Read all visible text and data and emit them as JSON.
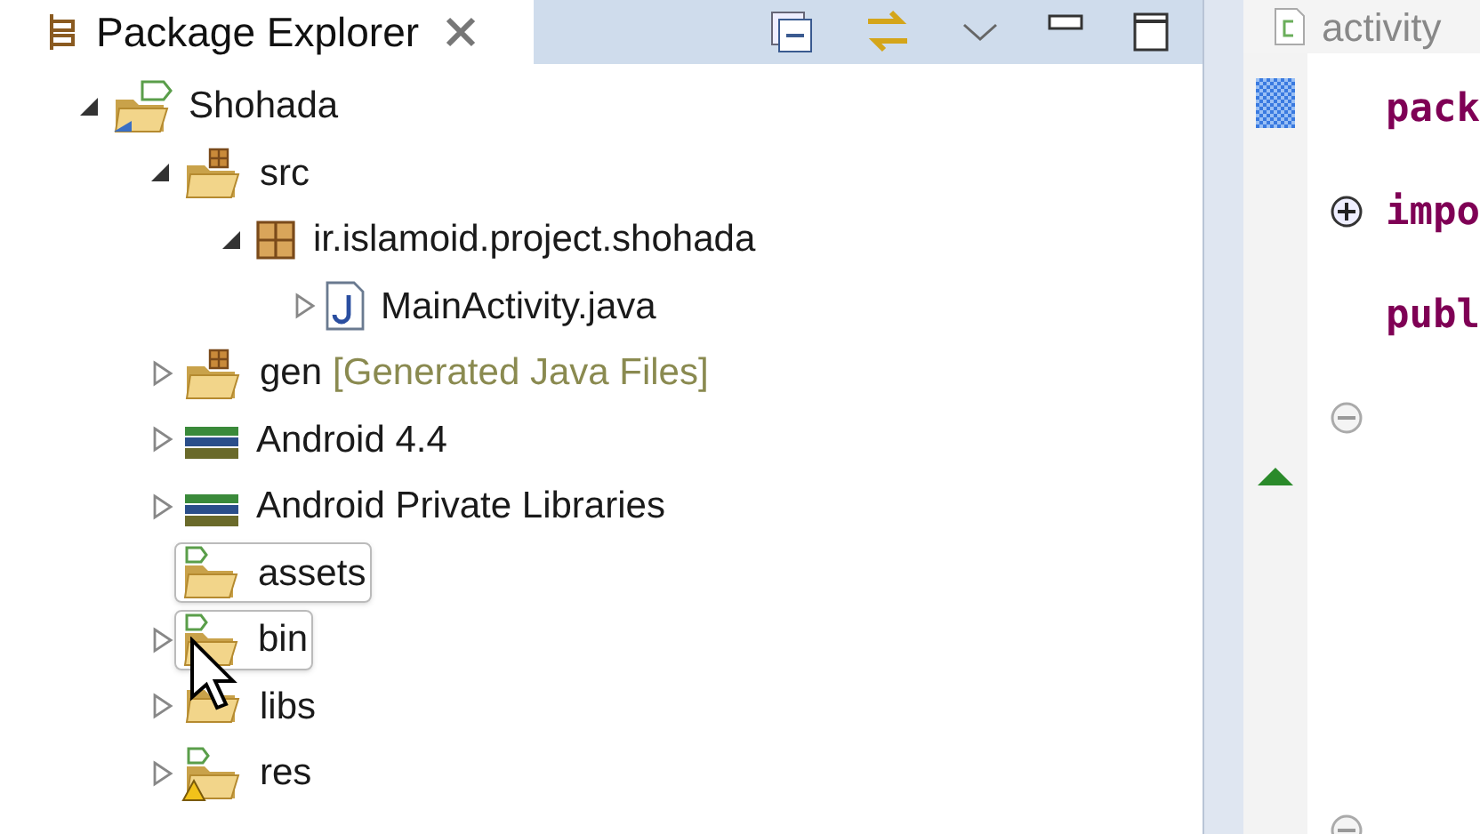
{
  "explorer": {
    "tab": {
      "title": "Package Explorer"
    },
    "tree": [
      {
        "label": "Shohada",
        "kind": "project",
        "expanded": true,
        "children": [
          {
            "label": "src",
            "kind": "source-folder",
            "expanded": true,
            "children": [
              {
                "label": "ir.islamoid.project.shohada",
                "kind": "package",
                "expanded": true,
                "children": [
                  {
                    "label": "MainActivity.java",
                    "kind": "java-file",
                    "expanded": false
                  }
                ]
              }
            ]
          },
          {
            "label": "gen",
            "decoration": "[Generated Java Files]",
            "kind": "source-folder",
            "expanded": false
          },
          {
            "label": "Android 4.4",
            "kind": "library",
            "expanded": false
          },
          {
            "label": "Android Private Libraries",
            "kind": "library",
            "expanded": false
          },
          {
            "label": "assets",
            "kind": "android-folder",
            "outlined": true
          },
          {
            "label": "bin",
            "kind": "android-folder",
            "expanded": false,
            "outlined": true
          },
          {
            "label": "libs",
            "kind": "folder",
            "expanded": false
          },
          {
            "label": "res",
            "kind": "warning-folder",
            "expanded": false
          }
        ]
      }
    ]
  },
  "editor": {
    "tab": {
      "title": "activity"
    },
    "lines": [
      {
        "kind": "code",
        "text": "pack"
      },
      {
        "kind": "code",
        "text": "impo",
        "expanded": false
      },
      {
        "kind": "code",
        "text": "publ"
      },
      {
        "kind": "blank",
        "expanded": true
      },
      {
        "kind": "blank"
      },
      {
        "kind": "blank"
      },
      {
        "kind": "blank"
      },
      {
        "kind": "blank",
        "expanded": true
      }
    ]
  }
}
